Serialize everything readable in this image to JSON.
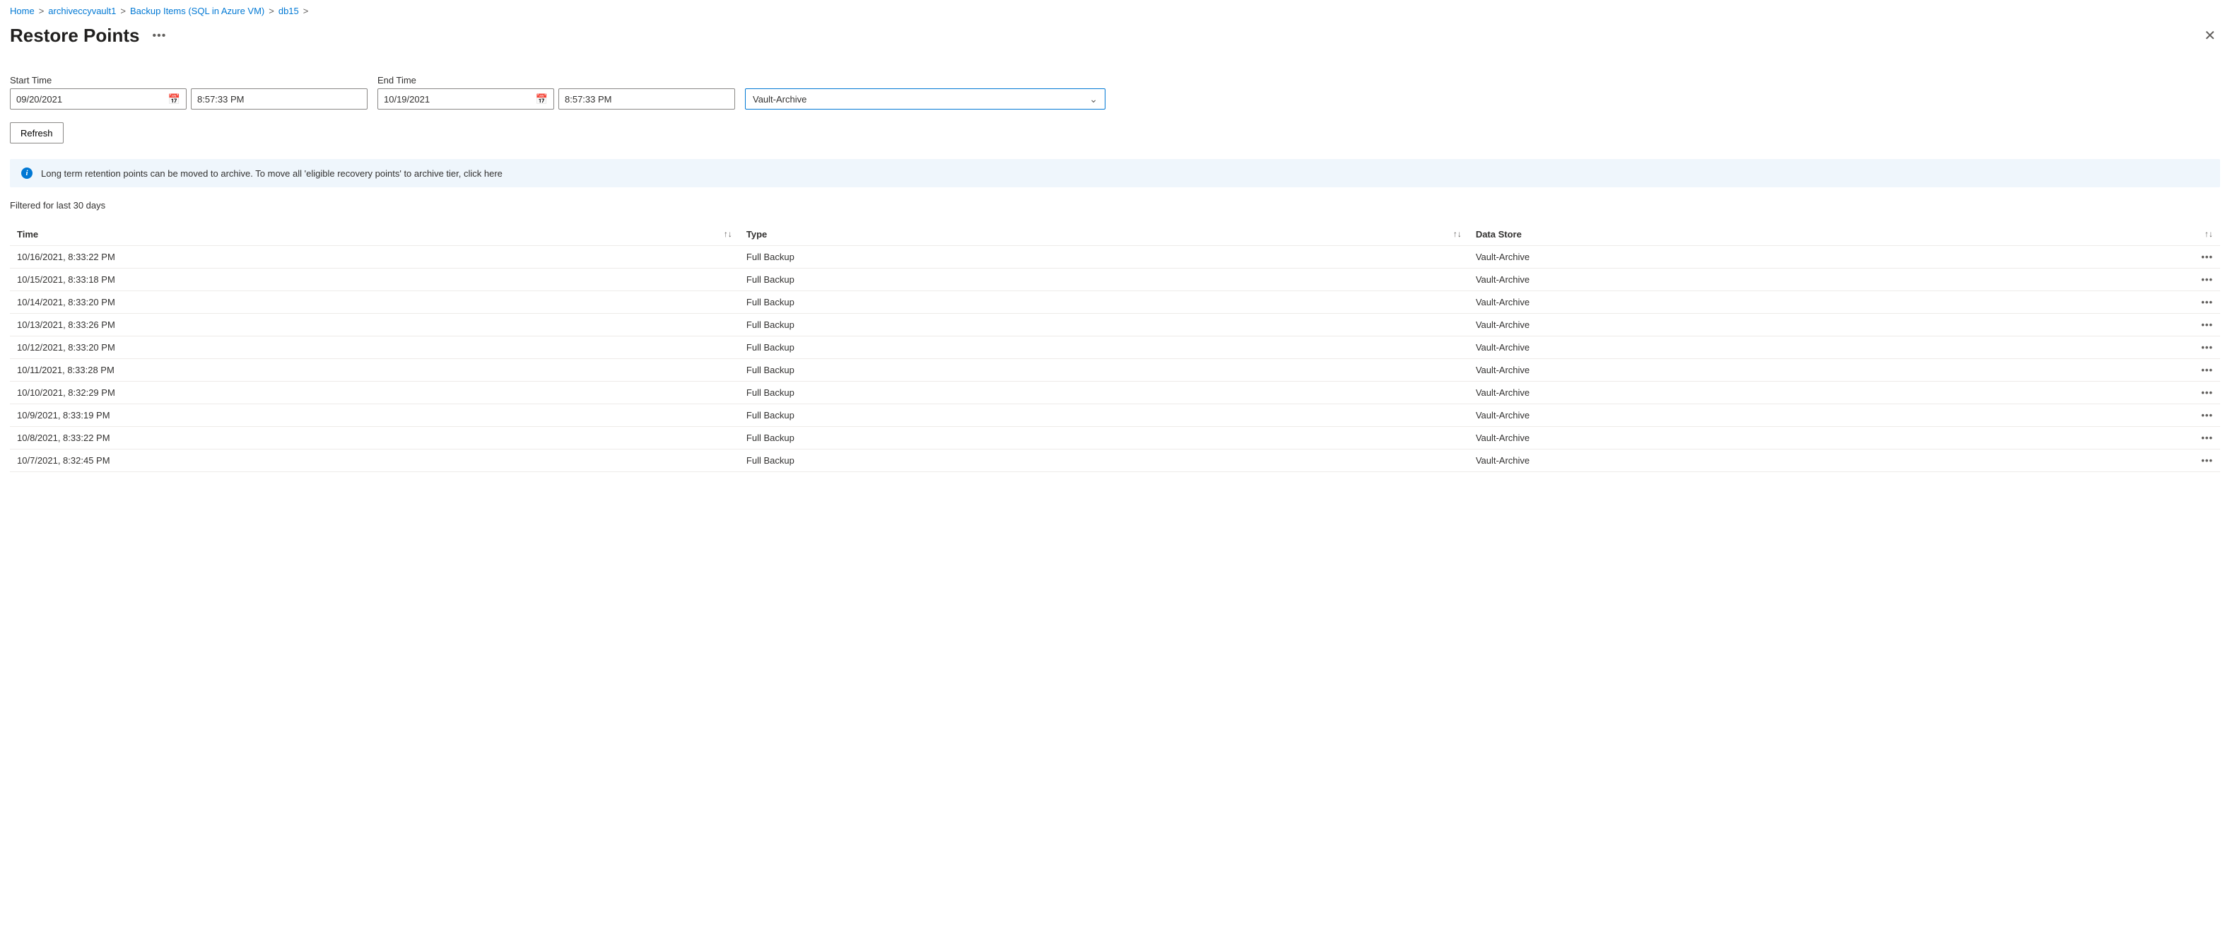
{
  "breadcrumb": {
    "items": [
      {
        "label": "Home"
      },
      {
        "label": "archiveccyvault1"
      },
      {
        "label": "Backup Items (SQL in Azure VM)"
      },
      {
        "label": "db15"
      }
    ]
  },
  "page": {
    "title": "Restore Points"
  },
  "filters": {
    "start": {
      "label": "Start Time",
      "date": "09/20/2021",
      "time": "8:57:33 PM"
    },
    "end": {
      "label": "End Time",
      "date": "10/19/2021",
      "time": "8:57:33 PM"
    },
    "tier": {
      "selected": "Vault-Archive"
    },
    "refresh_label": "Refresh"
  },
  "info_banner": {
    "text": "Long term retention points can be moved to archive. To move all 'eligible recovery points' to archive tier, click here"
  },
  "filter_status": "Filtered for last 30 days",
  "table": {
    "headers": {
      "time": "Time",
      "type": "Type",
      "data_store": "Data Store"
    },
    "rows": [
      {
        "time": "10/16/2021, 8:33:22 PM",
        "type": "Full Backup",
        "data_store": "Vault-Archive"
      },
      {
        "time": "10/15/2021, 8:33:18 PM",
        "type": "Full Backup",
        "data_store": "Vault-Archive"
      },
      {
        "time": "10/14/2021, 8:33:20 PM",
        "type": "Full Backup",
        "data_store": "Vault-Archive"
      },
      {
        "time": "10/13/2021, 8:33:26 PM",
        "type": "Full Backup",
        "data_store": "Vault-Archive"
      },
      {
        "time": "10/12/2021, 8:33:20 PM",
        "type": "Full Backup",
        "data_store": "Vault-Archive"
      },
      {
        "time": "10/11/2021, 8:33:28 PM",
        "type": "Full Backup",
        "data_store": "Vault-Archive"
      },
      {
        "time": "10/10/2021, 8:32:29 PM",
        "type": "Full Backup",
        "data_store": "Vault-Archive"
      },
      {
        "time": "10/9/2021, 8:33:19 PM",
        "type": "Full Backup",
        "data_store": "Vault-Archive"
      },
      {
        "time": "10/8/2021, 8:33:22 PM",
        "type": "Full Backup",
        "data_store": "Vault-Archive"
      },
      {
        "time": "10/7/2021, 8:32:45 PM",
        "type": "Full Backup",
        "data_store": "Vault-Archive"
      }
    ]
  }
}
